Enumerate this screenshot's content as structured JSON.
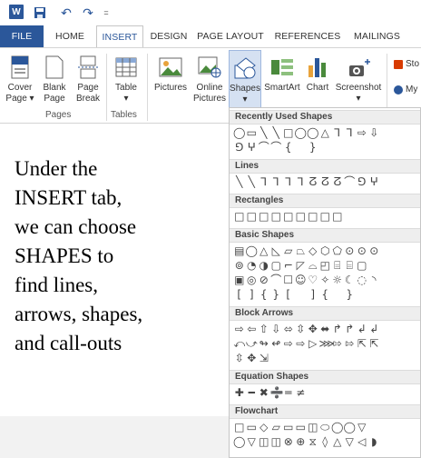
{
  "qat": {
    "word_logo": "W",
    "undo_glyph": "↶",
    "redo_glyph": "↷",
    "more_glyph": "="
  },
  "tabs": [
    {
      "label": "FILE"
    },
    {
      "label": "HOME"
    },
    {
      "label": "INSERT"
    },
    {
      "label": "DESIGN"
    },
    {
      "label": "PAGE LAYOUT"
    },
    {
      "label": "REFERENCES"
    },
    {
      "label": "MAILINGS"
    }
  ],
  "ribbon": {
    "cover_page": "Cover Page ▾",
    "blank_page": "Blank Page",
    "page_break": "Page Break",
    "table": "Table",
    "table_arrow": "▾",
    "pictures": "Pictures",
    "online_pictures": "Online Pictures",
    "shapes": "Shapes",
    "shapes_arrow": "▾",
    "smartart": "SmartArt",
    "chart": "Chart",
    "screenshot": "Screenshot",
    "screenshot_arrow": "▾",
    "store": "Sto",
    "my_apps": "My",
    "groups": {
      "pages": "Pages",
      "tables": "Tables"
    }
  },
  "dropdown": {
    "sections": [
      {
        "title": "Recently Used Shapes",
        "rows": [
          "◯▭╲╲□◯◯△⅂⅂⇨⇩",
          "⅁ⵖ⌒⌒{ }"
        ]
      },
      {
        "title": "Lines",
        "rows": [
          "╲╲⅂⅂⅂⅂ⵒⵒⵒ⌒⅁ⵖ"
        ]
      },
      {
        "title": "Rectangles",
        "rows": [
          "□□□□□□□□□"
        ]
      },
      {
        "title": "Basic Shapes",
        "rows": [
          "▤◯△◺▱⏢◇⬡⬠⊙⊙⊙",
          "⊚◔◑▢⌐◸⌓◰⌸⌸▢",
          "▣◎⊘⌒☐☺♡✧☼☾◌◝",
          "[]{}[ ]{ }"
        ]
      },
      {
        "title": "Block Arrows",
        "rows": [
          "⇨⇦⇧⇩⬄⇳✥⬌↱↱↲↲",
          "⤺⤻↬↫⇨⇨▷⋙⇰⇰⇱⇱",
          "⇳✥⇲"
        ]
      },
      {
        "title": "Equation Shapes",
        "rows": [
          "✚━✖➗═≠"
        ]
      },
      {
        "title": "Flowchart",
        "rows": [
          "□▭◇▱▭▭◫⬭◯◯▽",
          "◯▽◫◫⊗⊕⧖◊△▽◁◗"
        ]
      }
    ]
  },
  "caption": {
    "lines": [
      "Under the",
      "INSERT tab,",
      "we can choose",
      "SHAPES to",
      "find lines,",
      "arrows, shapes,",
      "and call-outs"
    ]
  }
}
